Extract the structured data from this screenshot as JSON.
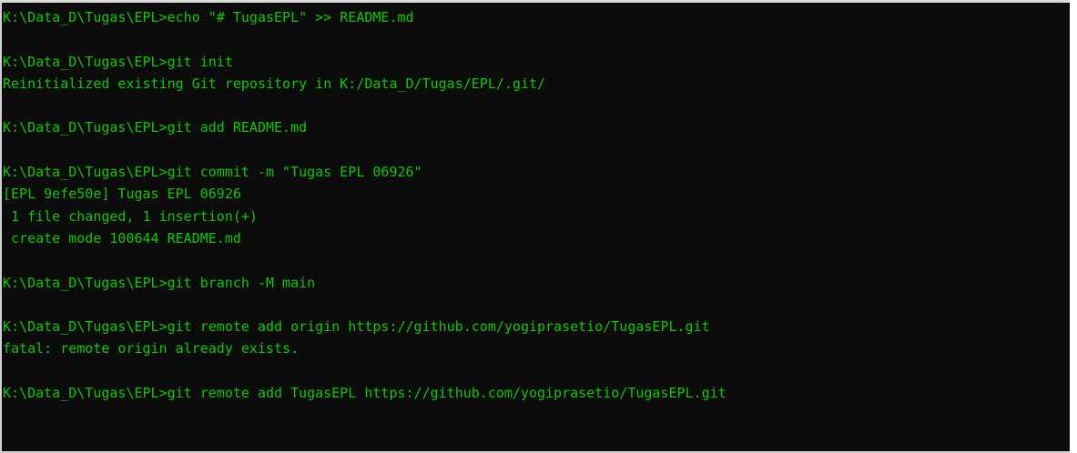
{
  "terminal": {
    "text_color": "#16C60C",
    "background_color": "#0C0C0C",
    "lines": [
      "K:\\Data_D\\Tugas\\EPL>echo \"# TugasEPL\" >> README.md",
      "",
      "K:\\Data_D\\Tugas\\EPL>git init",
      "Reinitialized existing Git repository in K:/Data_D/Tugas/EPL/.git/",
      "",
      "K:\\Data_D\\Tugas\\EPL>git add README.md",
      "",
      "K:\\Data_D\\Tugas\\EPL>git commit -m \"Tugas EPL 06926\"",
      "[EPL 9efe50e] Tugas EPL 06926",
      " 1 file changed, 1 insertion(+)",
      " create mode 100644 README.md",
      "",
      "K:\\Data_D\\Tugas\\EPL>git branch -M main",
      "",
      "K:\\Data_D\\Tugas\\EPL>git remote add origin https://github.com/yogiprasetio/TugasEPL.git",
      "fatal: remote origin already exists.",
      "",
      "K:\\Data_D\\Tugas\\EPL>git remote add TugasEPL https://github.com/yogiprasetio/TugasEPL.git"
    ]
  }
}
